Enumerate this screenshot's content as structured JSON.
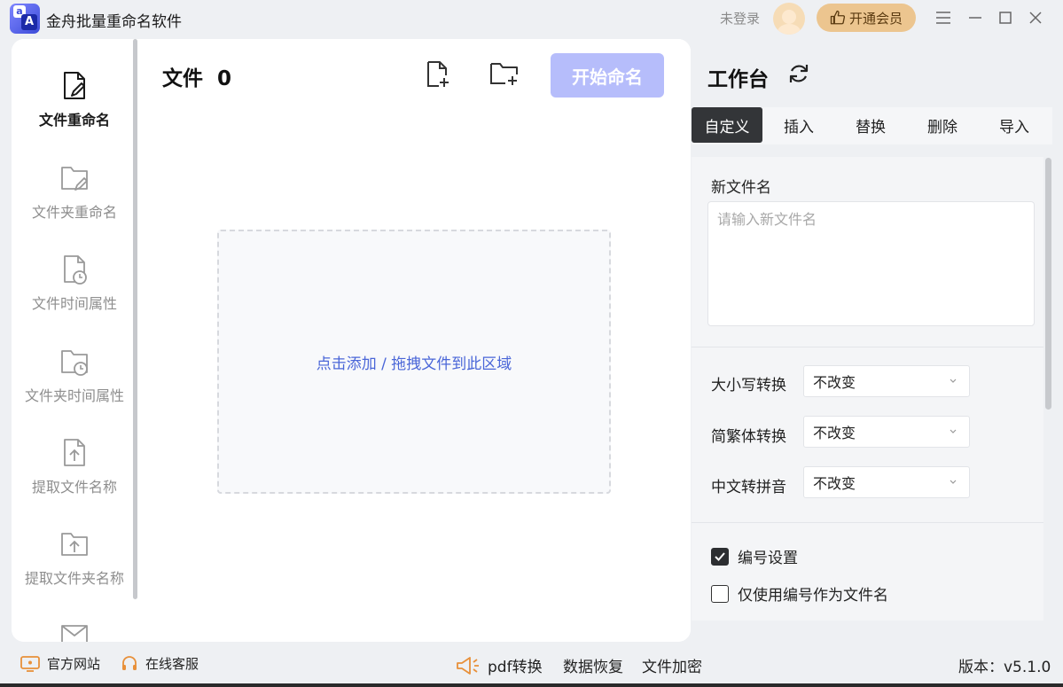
{
  "window": {
    "title": "金舟批量重命名软件",
    "login_status": "未登录",
    "vip_label": "开通会员"
  },
  "sidebar": {
    "items": [
      {
        "label": "文件重命名",
        "icon": "file-edit-icon",
        "active": true
      },
      {
        "label": "文件夹重命名",
        "icon": "folder-edit-icon",
        "active": false
      },
      {
        "label": "文件时间属性",
        "icon": "file-clock-icon",
        "active": false
      },
      {
        "label": "文件夹时间属性",
        "icon": "folder-clock-icon",
        "active": false
      },
      {
        "label": "提取文件名称",
        "icon": "file-upload-icon",
        "active": false
      },
      {
        "label": "提取文件夹名称",
        "icon": "folder-upload-icon",
        "active": false
      }
    ]
  },
  "content": {
    "file_label": "文件",
    "file_count": "0",
    "start_button": "开始命名",
    "dropzone_text": "点击添加 / 拖拽文件到此区域"
  },
  "workbench": {
    "title": "工作台",
    "tabs": [
      {
        "label": "自定义",
        "active": true
      },
      {
        "label": "插入",
        "active": false
      },
      {
        "label": "替换",
        "active": false
      },
      {
        "label": "删除",
        "active": false
      },
      {
        "label": "导入",
        "active": false
      }
    ],
    "new_name_label": "新文件名",
    "new_name_placeholder": "请输入新文件名",
    "case_label": "大小写转换",
    "case_value": "不改变",
    "trad_label": "简繁体转换",
    "trad_value": "不改变",
    "pinyin_label": "中文转拼音",
    "pinyin_value": "不改变",
    "numbering_label": "编号设置",
    "numbering_checked": true,
    "only_number_label": "仅使用编号作为文件名",
    "only_number_checked": false
  },
  "footer": {
    "website": "官方网站",
    "support": "在线客服",
    "pdf": "pdf转换",
    "recovery": "数据恢复",
    "encrypt": "文件加密",
    "version": "版本：v5.1.0"
  },
  "colors": {
    "accent": "#b6bdfb",
    "link": "#4a66d8",
    "active_tab": "#333538",
    "vip": "#ecc58f",
    "footer_icon": "#e8903a"
  }
}
